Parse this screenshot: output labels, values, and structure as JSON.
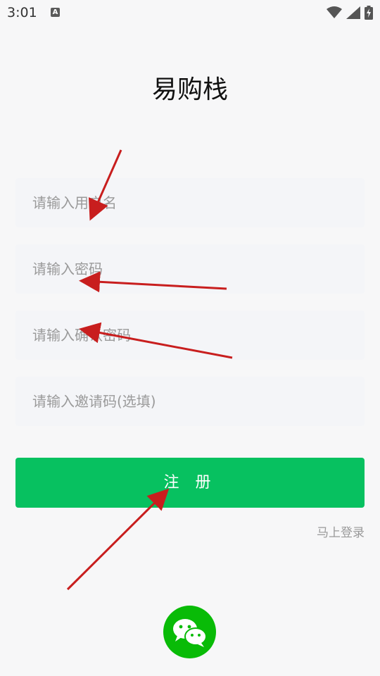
{
  "status_bar": {
    "time": "3:01",
    "notification_icon": "A"
  },
  "app": {
    "title": "易购栈"
  },
  "form": {
    "username_placeholder": "请输入用户名",
    "password_placeholder": "请输入密码",
    "confirm_password_placeholder": "请输入确认密码",
    "invite_code_placeholder": "请输入邀请码(选填)",
    "register_label": "注 册",
    "login_link_label": "马上登录"
  },
  "colors": {
    "primary_green": "#07c160",
    "wechat_green": "#09bb07",
    "annotation_red": "#c81e1e"
  },
  "icons": {
    "wechat": "wechat-icon",
    "wifi": "wifi-icon",
    "signal": "signal-icon",
    "battery": "battery-icon"
  }
}
